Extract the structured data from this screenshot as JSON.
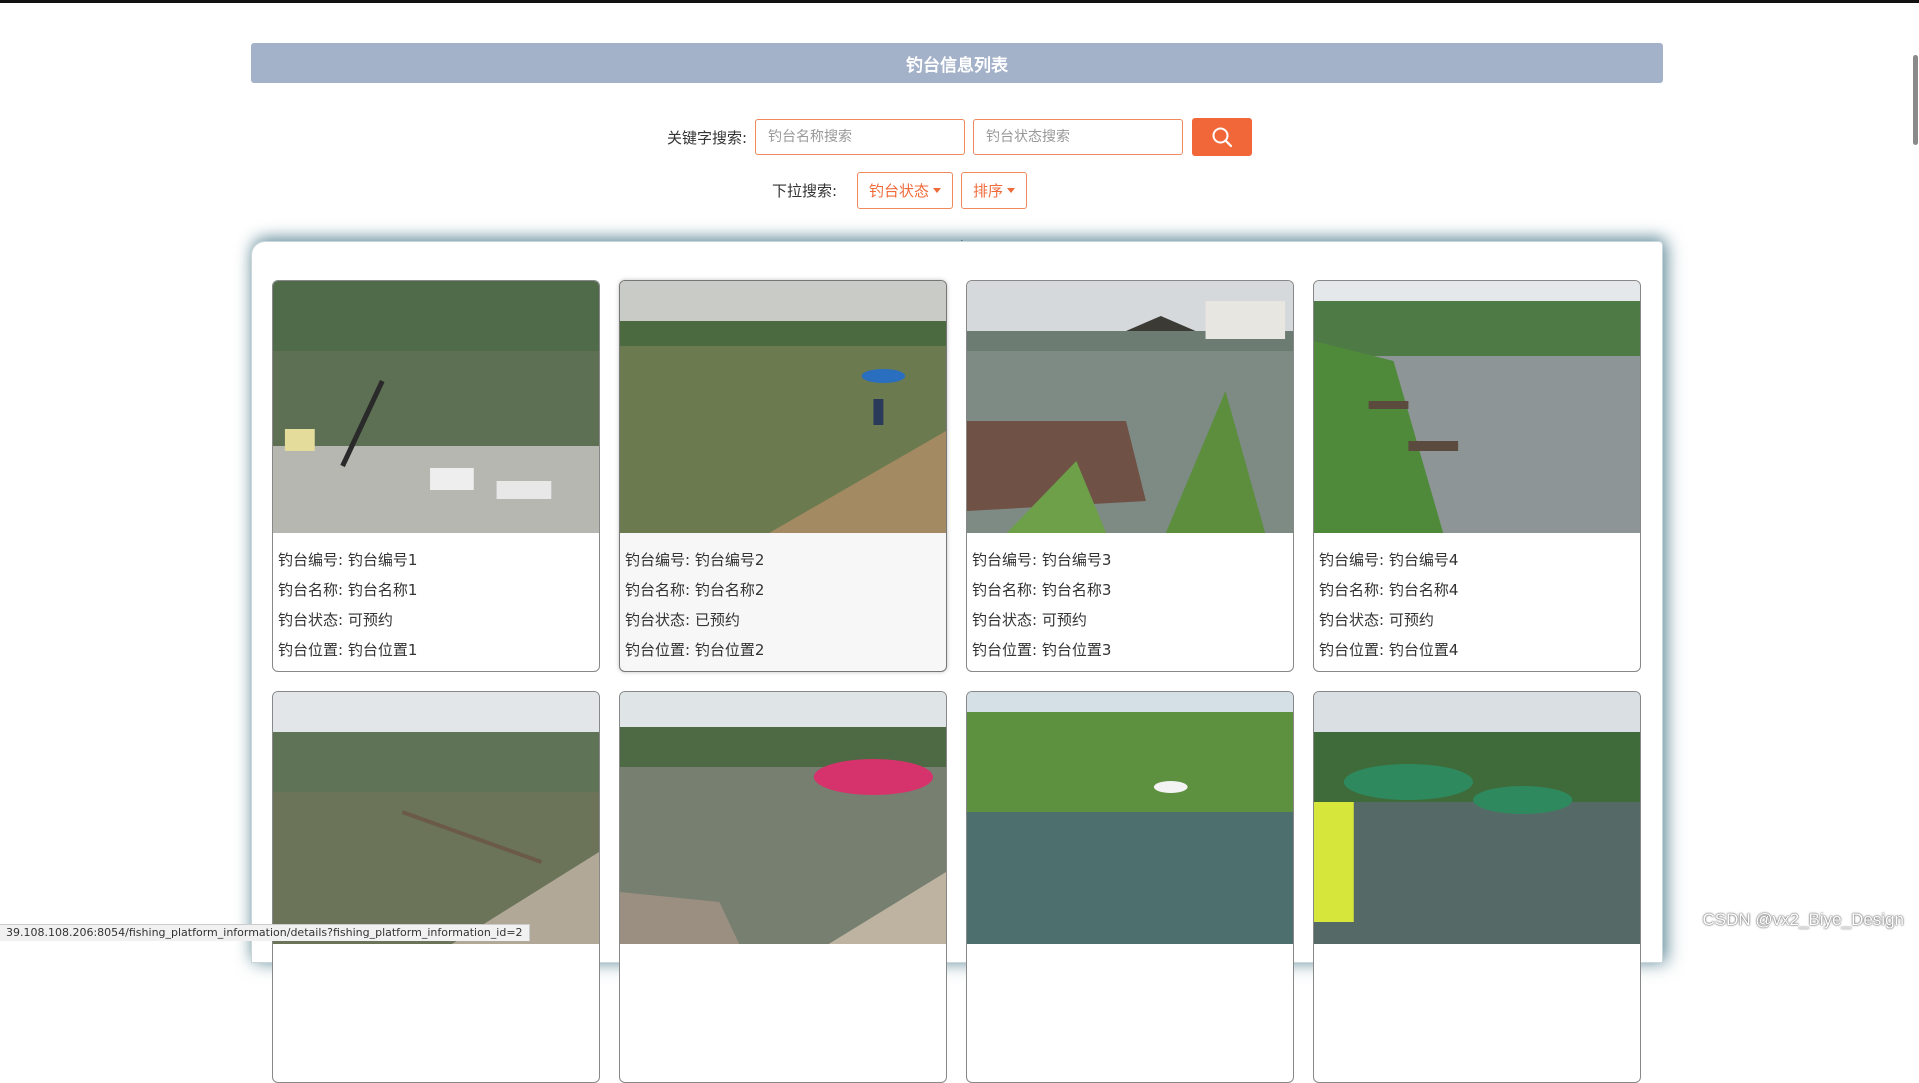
{
  "header": {
    "title": "钓台信息列表"
  },
  "search": {
    "label": "关键字搜索:",
    "name_placeholder": "钓台名称搜索",
    "status_placeholder": "钓台状态搜索",
    "button_icon": "search-icon"
  },
  "dropdowns": {
    "label": "下拉搜索:",
    "status_label": "钓台状态",
    "sort_label": "排序"
  },
  "cards": [
    {
      "no": "钓台编号: 钓台编号1",
      "name": "钓台名称: 钓台名称1",
      "status": "钓台状态: 可预约",
      "location": "钓台位置: 钓台位置1"
    },
    {
      "no": "钓台编号: 钓台编号2",
      "name": "钓台名称: 钓台名称2",
      "status": "钓台状态: 已预约",
      "location": "钓台位置: 钓台位置2"
    },
    {
      "no": "钓台编号: 钓台编号3",
      "name": "钓台名称: 钓台名称3",
      "status": "钓台状态: 可预约",
      "location": "钓台位置: 钓台位置3"
    },
    {
      "no": "钓台编号: 钓台编号4",
      "name": "钓台名称: 钓台名称4",
      "status": "钓台状态: 可预约",
      "location": "钓台位置: 钓台位置4"
    }
  ],
  "status_bar": {
    "url": "39.108.108.206:8054/fishing_platform_information/details?fishing_platform_information_id=2"
  },
  "watermark": "CSDN @vx2_Biye_Design",
  "colors": {
    "accent": "#f2673a",
    "title_bar": "#a3b1c9"
  }
}
